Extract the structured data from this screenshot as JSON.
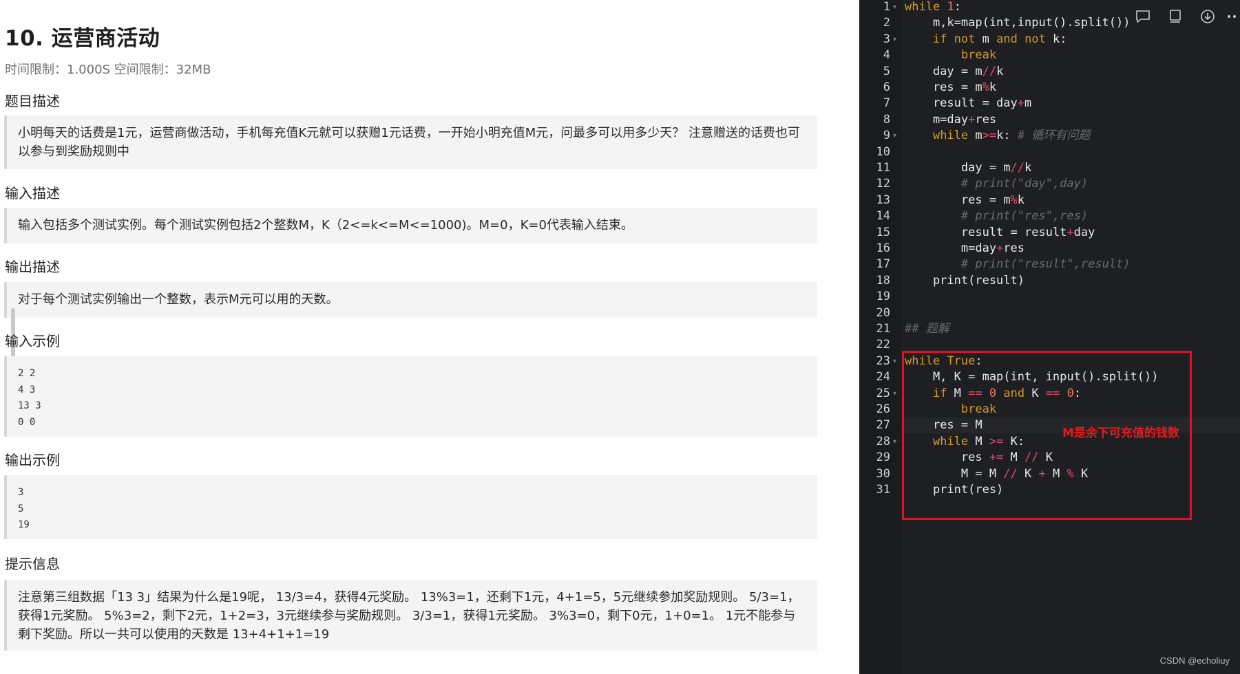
{
  "problem": {
    "title": "10. 运营商活动",
    "limits": "时间限制：1.000S  空间限制：32MB",
    "sections": {
      "desc_heading": "题目描述",
      "desc_text": "小明每天的话费是1元，运营商做活动，手机每充值K元就可以获赠1元话费，一开始小明充值M元，问最多可以用多少天？ 注意赠送的话费也可以参与到奖励规则中",
      "input_heading": "输入描述",
      "input_text": "输入包括多个测试实例。每个测试实例包括2个整数M，K（2<=k<=M<=1000)。M=0，K=0代表输入结束。",
      "output_heading": "输出描述",
      "output_text": "对于每个测试实例输出一个整数，表示M元可以用的天数。",
      "sample_in_heading": "输入示例",
      "sample_in": "2 2\n4 3\n13 3\n0 0",
      "sample_out_heading": "输出示例",
      "sample_out": "3\n5\n19",
      "hint_heading": "提示信息",
      "hint_text": "注意第三组数据「13 3」结果为什么是19呢， 13/3=4，获得4元奖励。 13%3=1，还剩下1元，4+1=5，5元继续参加奖励规则。 5/3=1，获得1元奖励。 5%3=2，剩下2元，1+2=3，3元继续参与奖励规则。 3/3=1，获得1元奖励。 3%3=0，剩下0元，1+0=1。 1元不能参与剩下奖励。所以一共可以使用的天数是 13+4+1+1=19"
    }
  },
  "editor": {
    "line_numbers": [
      "1",
      "2",
      "3",
      "4",
      "5",
      "6",
      "7",
      "8",
      "9",
      "10",
      "11",
      "12",
      "13",
      "14",
      "15",
      "16",
      "17",
      "18",
      "19",
      "20",
      "21",
      "22",
      "23",
      "24",
      "25",
      "26",
      "27",
      "28",
      "29",
      "30",
      "31"
    ],
    "lines": [
      "while 1:",
      "    m,k=map(int,input().split())",
      "    if not m and not k:",
      "        break",
      "    day = m//k",
      "    res = m%k",
      "    result = day+m",
      "    m=day+res",
      "    while m>=k: # 循环有问题",
      "",
      "        day = m//k",
      "        # print(\"day\",day)",
      "        res = m%k",
      "        # print(\"res\",res)",
      "        result = result+day",
      "        m=day+res",
      "        # print(\"result\",result)",
      "    print(result)",
      "",
      "",
      "## 题解",
      "",
      "while True:",
      "    M, K = map(int, input().split())",
      "    if M == 0 and K == 0:",
      "        break",
      "    res = M",
      "    while M >= K:",
      "        res += M // K",
      "        M = M // K + M % K",
      "    print(res)"
    ],
    "annotation": "M是余下可充值的钱数",
    "toolbar": [
      "comment-icon",
      "tablet-icon",
      "download-icon",
      "more-icon"
    ],
    "watermark": "CSDN @echoliuy",
    "colors": {
      "keyword": "#d19a2d",
      "number": "#e07b5b",
      "operator": "#e34a6a",
      "highlight": "#e0102a"
    }
  }
}
